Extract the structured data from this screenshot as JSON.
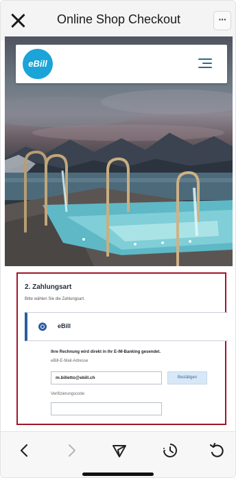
{
  "header": {
    "title": "Online Shop Checkout",
    "more_label": "···"
  },
  "site": {
    "logo_text": "eBill"
  },
  "payment": {
    "section_title": "2. Zahlungsart",
    "section_subtitle": "Bitte wählen Sie die Zahlungsart.",
    "option_label": "eBill",
    "info_text": "Ihre Rechnung wird direkt in Ihr E-/M-Banking gesendet.",
    "email_label": "eBill-E-Mail-Adresse",
    "email_value": "m.billetto@ebill.ch",
    "confirm_label": "Bestätigen",
    "code_label": "Verifizierungscode"
  },
  "colors": {
    "highlight_border": "#a0142a",
    "accent_blue": "#2a5d9f",
    "logo_blue": "#1aa4d8"
  },
  "toolbar": {
    "icons": [
      "chevron-left-icon",
      "chevron-right-icon",
      "share-icon",
      "history-icon",
      "reload-icon"
    ]
  }
}
